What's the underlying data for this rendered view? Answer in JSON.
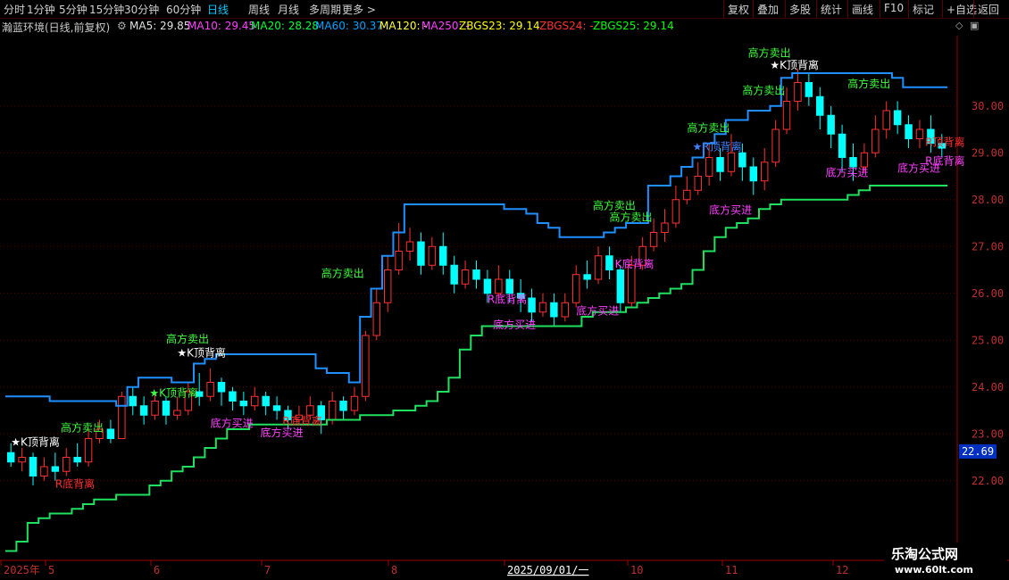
{
  "toolbar": {
    "left": [
      "分时",
      "1分钟",
      "5分钟",
      "15分钟",
      "30分钟",
      "60分钟",
      "日线",
      "周线",
      "月线",
      "多周期",
      "更多 >"
    ],
    "active": "日线",
    "right": [
      "复权",
      "叠加",
      "多股",
      "统计",
      "画线",
      "F10",
      "标记",
      "+自选",
      "返回"
    ]
  },
  "info": {
    "title": "瀚蓝环境(日线,前复权)",
    "ma5": "MA5: 29.85",
    "ma10": "MA10: 29.45",
    "ma20": "MA20: 28.28",
    "ma60": "MA60: 30.37",
    "ma120": "MA120: -",
    "ma250": "MA250: -",
    "zb23": "ZBGS23: 29.14",
    "zb24": "ZBGS24: -",
    "zb25": "ZBGS25: 29.14",
    "colors": {
      "ma5": "#e0e0e0",
      "ma10": "#ff40ff",
      "ma20": "#00ff40",
      "ma60": "#00a0ff",
      "ma120": "#ffff40",
      "ma250": "#ff40ff",
      "zb23": "#ffff00",
      "zb24": "#ff3030",
      "zb25": "#00ff00"
    }
  },
  "price_axis": {
    "ticks": [
      "30.00",
      "29.00",
      "28.00",
      "27.00",
      "26.00",
      "25.00",
      "24.00",
      "23.00",
      "22.00"
    ],
    "current": "22.69"
  },
  "time_axis": {
    "labels": [
      "2025年",
      "5",
      "6",
      "7",
      "8",
      "2025/09/01/一",
      "10",
      "11",
      "12"
    ]
  },
  "watermark": {
    "line1": "乐淘公式网",
    "line2": "www.60lt.com"
  },
  "chart_data": {
    "type": "candlestick",
    "ylim": [
      20.3,
      31.5
    ],
    "grid": true,
    "series": [
      {
        "name": "上轨",
        "color": "#1e90ff",
        "values": [
          23.8,
          23.8,
          23.8,
          23.8,
          23.7,
          23.7,
          23.7,
          23.7,
          23.7,
          23.7,
          23.6,
          24.0,
          24.2,
          24.2,
          24.2,
          24.1,
          24.1,
          24.5,
          24.6,
          24.7,
          24.7,
          24.7,
          24.7,
          24.7,
          24.7,
          24.7,
          24.7,
          24.7,
          24.4,
          24.3,
          24.3,
          24.1,
          25.5,
          26.1,
          26.8,
          27.3,
          27.9,
          27.9,
          27.9,
          27.9,
          27.9,
          27.9,
          27.9,
          27.9,
          27.9,
          27.8,
          27.8,
          27.7,
          27.5,
          27.4,
          27.2,
          27.2,
          27.2,
          27.2,
          27.3,
          27.4,
          27.5,
          27.5,
          28.3,
          28.3,
          28.5,
          28.7,
          28.9,
          29.2,
          29.4,
          29.7,
          29.7,
          29.9,
          29.9,
          30.0,
          30.6,
          30.7,
          30.7,
          30.7,
          30.7,
          30.7,
          30.7,
          30.7,
          30.7,
          30.7,
          30.6,
          30.4,
          30.4,
          30.4,
          30.4
        ]
      },
      {
        "name": "下轨",
        "color": "#20e060",
        "values": [
          20.5,
          20.7,
          21.1,
          21.2,
          21.3,
          21.3,
          21.4,
          21.5,
          21.6,
          21.6,
          21.7,
          21.7,
          21.7,
          21.9,
          22.0,
          22.2,
          22.3,
          22.5,
          22.7,
          22.9,
          23.1,
          23.1,
          23.2,
          23.2,
          23.2,
          23.2,
          23.2,
          23.2,
          23.2,
          23.3,
          23.3,
          23.3,
          23.4,
          23.4,
          23.4,
          23.5,
          23.5,
          23.6,
          23.7,
          23.9,
          24.2,
          24.8,
          25.1,
          25.3,
          25.3,
          25.3,
          25.3,
          25.3,
          25.3,
          25.3,
          25.3,
          25.3,
          25.5,
          25.6,
          25.6,
          25.6,
          25.7,
          25.8,
          25.9,
          26.0,
          26.1,
          26.2,
          26.5,
          26.9,
          27.2,
          27.4,
          27.5,
          27.6,
          27.8,
          27.9,
          28.0,
          28.0,
          28.0,
          28.0,
          28.0,
          28.0,
          28.1,
          28.2,
          28.3,
          28.3,
          28.3,
          28.3,
          28.3,
          28.3,
          28.3
        ]
      }
    ],
    "candles": [
      [
        22.6,
        22.4,
        22.8,
        22.3
      ],
      [
        22.4,
        22.5,
        22.7,
        22.2
      ],
      [
        22.5,
        22.1,
        22.6,
        21.9
      ],
      [
        22.1,
        22.3,
        22.5,
        22.0
      ],
      [
        22.3,
        22.2,
        22.6,
        22.0
      ],
      [
        22.2,
        22.5,
        22.7,
        22.1
      ],
      [
        22.5,
        22.4,
        22.8,
        22.3
      ],
      [
        22.4,
        22.9,
        23.1,
        22.3
      ],
      [
        22.9,
        23.1,
        23.3,
        22.8
      ],
      [
        23.1,
        22.9,
        23.3,
        22.8
      ],
      [
        22.9,
        23.8,
        23.9,
        22.9
      ],
      [
        23.8,
        23.6,
        24.0,
        23.4
      ],
      [
        23.6,
        23.4,
        23.8,
        23.2
      ],
      [
        23.4,
        23.7,
        23.9,
        23.3
      ],
      [
        23.7,
        23.4,
        23.8,
        23.2
      ],
      [
        23.4,
        23.5,
        23.8,
        23.3
      ],
      [
        23.5,
        23.9,
        24.1,
        23.4
      ],
      [
        23.9,
        23.8,
        24.3,
        23.6
      ],
      [
        23.8,
        24.1,
        24.4,
        23.7
      ],
      [
        24.1,
        23.9,
        24.2,
        23.6
      ],
      [
        23.9,
        23.7,
        24.0,
        23.5
      ],
      [
        23.7,
        23.6,
        23.9,
        23.4
      ],
      [
        23.6,
        23.8,
        24.0,
        23.5
      ],
      [
        23.8,
        23.6,
        23.9,
        23.4
      ],
      [
        23.6,
        23.5,
        23.8,
        23.3
      ],
      [
        23.5,
        23.3,
        23.6,
        23.1
      ],
      [
        23.3,
        23.4,
        23.6,
        23.2
      ],
      [
        23.4,
        23.6,
        23.8,
        23.3
      ],
      [
        23.6,
        23.3,
        23.7,
        23.0
      ],
      [
        23.3,
        23.7,
        23.9,
        23.2
      ],
      [
        23.7,
        23.5,
        23.8,
        23.3
      ],
      [
        23.5,
        23.8,
        24.0,
        23.4
      ],
      [
        23.8,
        25.1,
        25.2,
        23.7
      ],
      [
        25.1,
        25.8,
        26.1,
        25.0
      ],
      [
        25.8,
        26.5,
        26.8,
        25.6
      ],
      [
        26.5,
        26.9,
        27.5,
        26.4
      ],
      [
        26.9,
        27.1,
        27.4,
        26.7
      ],
      [
        27.1,
        26.6,
        27.3,
        26.4
      ],
      [
        26.6,
        27.0,
        27.2,
        26.5
      ],
      [
        27.0,
        26.6,
        27.3,
        26.4
      ],
      [
        26.6,
        26.2,
        26.8,
        26.0
      ],
      [
        26.2,
        26.5,
        26.7,
        26.1
      ],
      [
        26.5,
        26.3,
        26.7,
        26.1
      ],
      [
        26.3,
        26.0,
        26.5,
        25.8
      ],
      [
        26.0,
        26.3,
        26.6,
        25.9
      ],
      [
        26.3,
        26.0,
        26.5,
        25.8
      ],
      [
        26.0,
        25.9,
        26.3,
        25.6
      ],
      [
        25.9,
        25.6,
        26.1,
        25.4
      ],
      [
        25.6,
        25.8,
        26.0,
        25.5
      ],
      [
        25.8,
        25.5,
        26.0,
        25.3
      ],
      [
        25.5,
        25.8,
        26.0,
        25.4
      ],
      [
        25.8,
        26.4,
        26.6,
        25.7
      ],
      [
        26.4,
        26.3,
        26.7,
        26.1
      ],
      [
        26.3,
        26.8,
        27.0,
        26.2
      ],
      [
        26.8,
        26.5,
        27.0,
        26.3
      ],
      [
        26.5,
        25.8,
        26.6,
        25.6
      ],
      [
        25.8,
        26.6,
        26.8,
        25.7
      ],
      [
        26.6,
        27.0,
        27.2,
        26.5
      ],
      [
        27.0,
        27.3,
        27.6,
        26.9
      ],
      [
        27.3,
        27.5,
        27.8,
        27.1
      ],
      [
        27.5,
        28.0,
        28.3,
        27.4
      ],
      [
        28.0,
        28.2,
        28.5,
        27.9
      ],
      [
        28.2,
        28.5,
        28.8,
        28.1
      ],
      [
        28.5,
        28.9,
        29.2,
        28.3
      ],
      [
        28.9,
        28.6,
        29.1,
        28.4
      ],
      [
        28.6,
        29.0,
        29.4,
        28.5
      ],
      [
        29.0,
        28.7,
        29.2,
        28.4
      ],
      [
        28.7,
        28.4,
        28.9,
        28.1
      ],
      [
        28.4,
        28.8,
        29.1,
        28.2
      ],
      [
        28.8,
        29.5,
        29.7,
        28.7
      ],
      [
        29.5,
        30.1,
        30.4,
        29.4
      ],
      [
        30.1,
        30.5,
        30.8,
        29.9
      ],
      [
        30.5,
        30.2,
        30.7,
        30.0
      ],
      [
        30.2,
        29.8,
        30.4,
        29.5
      ],
      [
        29.8,
        29.4,
        30.0,
        29.1
      ],
      [
        29.4,
        28.9,
        29.6,
        28.6
      ],
      [
        28.9,
        28.7,
        29.2,
        28.4
      ],
      [
        28.7,
        29.0,
        29.2,
        28.6
      ],
      [
        29.0,
        29.5,
        29.8,
        28.9
      ],
      [
        29.5,
        29.9,
        30.1,
        29.3
      ],
      [
        29.9,
        29.6,
        30.1,
        29.4
      ],
      [
        29.6,
        29.3,
        29.8,
        29.1
      ],
      [
        29.3,
        29.5,
        29.7,
        29.1
      ],
      [
        29.5,
        29.2,
        29.8,
        29.0
      ],
      [
        29.2,
        29.1,
        29.4,
        28.9
      ]
    ],
    "annotations": [
      {
        "text": "★K顶背离",
        "x": 1,
        "y": 22.75,
        "color": "#ffffff"
      },
      {
        "text": "高方卖出",
        "x": 10,
        "y": 23.05,
        "color": "#40ff40"
      },
      {
        "text": "R底背离",
        "x": 9,
        "y": 21.85,
        "color": "#ff3030"
      },
      {
        "text": "高方卖出",
        "x": 29,
        "y": 24.95,
        "color": "#40ff40"
      },
      {
        "text": "★K顶背离",
        "x": 31,
        "y": 24.65,
        "color": "#ffffff"
      },
      {
        "text": "★K顶背离",
        "x": 26,
        "y": 23.8,
        "color": "#40ff40"
      },
      {
        "text": "底方买进",
        "x": 37,
        "y": 23.15,
        "color": "#ff40ff"
      },
      {
        "text": "底方买进",
        "x": 46,
        "y": 22.95,
        "color": "#ff40ff"
      },
      {
        "text": "R底背离",
        "x": 50,
        "y": 23.2,
        "color": "#ff3030"
      },
      {
        "text": "高方卖出",
        "x": 57,
        "y": 26.35,
        "color": "#40ff40"
      },
      {
        "text": "R底背离",
        "x": 87,
        "y": 25.8,
        "color": "#ff40ff"
      },
      {
        "text": "底方买进",
        "x": 88,
        "y": 25.25,
        "color": "#ff40ff"
      },
      {
        "text": "底方买进",
        "x": 103,
        "y": 25.55,
        "color": "#ff40ff"
      },
      {
        "text": "K底背离",
        "x": 110,
        "y": 26.55,
        "color": "#ff40ff"
      },
      {
        "text": "高方卖出",
        "x": 106,
        "y": 27.8,
        "color": "#40ff40"
      },
      {
        "text": "高方卖出",
        "x": 109,
        "y": 27.55,
        "color": "#40ff40"
      },
      {
        "text": "底方买进",
        "x": 127,
        "y": 27.7,
        "color": "#ff40ff"
      },
      {
        "text": "高方卖出",
        "x": 123,
        "y": 29.45,
        "color": "#40ff40"
      },
      {
        "text": "★R顶背离",
        "x": 124,
        "y": 29.05,
        "color": "#4080ff"
      },
      {
        "text": "高方卖出",
        "x": 134,
        "y": 31.05,
        "color": "#40ff40"
      },
      {
        "text": "★K顶背离",
        "x": 138,
        "y": 30.8,
        "color": "#ffffff"
      },
      {
        "text": "高方卖出",
        "x": 133,
        "y": 30.25,
        "color": "#40ff40"
      },
      {
        "text": "高方卖出",
        "x": 152,
        "y": 30.4,
        "color": "#40ff40"
      },
      {
        "text": "底方买进",
        "x": 148,
        "y": 28.5,
        "color": "#ff40ff"
      },
      {
        "text": "底方买进",
        "x": 161,
        "y": 28.6,
        "color": "#ff40ff"
      },
      {
        "text": "R底背离",
        "x": 166,
        "y": 28.75,
        "color": "#ff40ff"
      },
      {
        "text": "R顶背离",
        "x": 166,
        "y": 29.15,
        "color": "#ff3030"
      }
    ]
  }
}
